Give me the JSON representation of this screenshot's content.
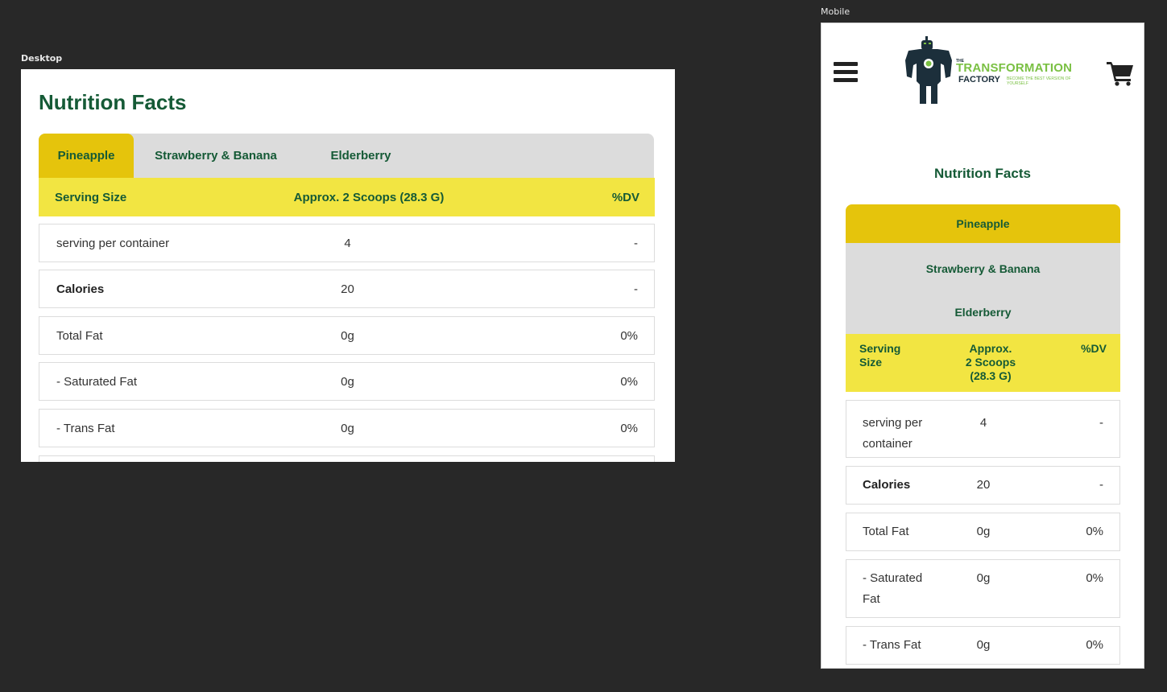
{
  "labels": {
    "desktop": "Desktop",
    "mobile": "Mobile"
  },
  "title": "Nutrition Facts",
  "tabs": [
    "Pineapple",
    "Strawberry & Banana",
    "Elderberry"
  ],
  "active_tab": 0,
  "serving": {
    "label": "Serving Size",
    "value": "Approx. 2 Scoops (28.3 G)",
    "dv": "%DV",
    "mobile_label_lines": [
      "Serving",
      "Size"
    ],
    "mobile_value_lines": [
      "Approx.",
      "2 Scoops",
      "(28.3 G)"
    ]
  },
  "rows": [
    {
      "name": "serving per container",
      "mobile_lines": [
        "serving per",
        "container"
      ],
      "amount": "4",
      "dv": "-",
      "bold": false
    },
    {
      "name": "Calories",
      "mobile_lines": [
        "Calories"
      ],
      "amount": "20",
      "dv": "-",
      "bold": true
    },
    {
      "name": "Total Fat",
      "mobile_lines": [
        "Total Fat"
      ],
      "amount": "0g",
      "dv": "0%",
      "bold": false
    },
    {
      "name": "- Saturated Fat",
      "mobile_lines": [
        "- Saturated",
        "Fat"
      ],
      "amount": "0g",
      "dv": "0%",
      "bold": false
    },
    {
      "name": "- Trans Fat",
      "mobile_lines": [
        "- Trans Fat"
      ],
      "amount": "0g",
      "dv": "0%",
      "bold": false
    }
  ],
  "logo": {
    "the": "THE",
    "line1": "TRANSFORMATION",
    "line2": "FACTORY",
    "tagline": "BECOME THE BEST VERSION OF YOURSELF"
  },
  "colors": {
    "brand_green": "#155a36",
    "tab_active": "#e5c40c",
    "tab_inactive": "#dcdcdc",
    "serving_bg": "#f2e542",
    "logo_green": "#7ac043"
  },
  "icons": {
    "menu": "hamburger-menu-icon",
    "cart": "shopping-cart-icon",
    "logo": "robot-logo-icon"
  }
}
